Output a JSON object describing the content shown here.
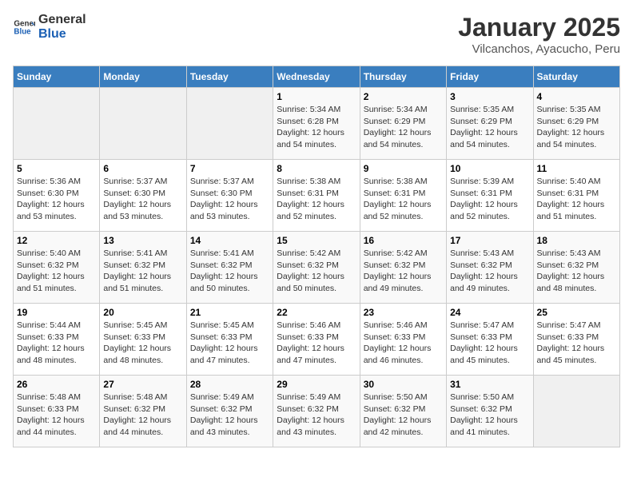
{
  "header": {
    "logo_line1": "General",
    "logo_line2": "Blue",
    "title": "January 2025",
    "subtitle": "Vilcanchos, Ayacucho, Peru"
  },
  "days_of_week": [
    "Sunday",
    "Monday",
    "Tuesday",
    "Wednesday",
    "Thursday",
    "Friday",
    "Saturday"
  ],
  "weeks": [
    [
      {
        "day": "",
        "info": ""
      },
      {
        "day": "",
        "info": ""
      },
      {
        "day": "",
        "info": ""
      },
      {
        "day": "1",
        "info": "Sunrise: 5:34 AM\nSunset: 6:28 PM\nDaylight: 12 hours\nand 54 minutes."
      },
      {
        "day": "2",
        "info": "Sunrise: 5:34 AM\nSunset: 6:29 PM\nDaylight: 12 hours\nand 54 minutes."
      },
      {
        "day": "3",
        "info": "Sunrise: 5:35 AM\nSunset: 6:29 PM\nDaylight: 12 hours\nand 54 minutes."
      },
      {
        "day": "4",
        "info": "Sunrise: 5:35 AM\nSunset: 6:29 PM\nDaylight: 12 hours\nand 54 minutes."
      }
    ],
    [
      {
        "day": "5",
        "info": "Sunrise: 5:36 AM\nSunset: 6:30 PM\nDaylight: 12 hours\nand 53 minutes."
      },
      {
        "day": "6",
        "info": "Sunrise: 5:37 AM\nSunset: 6:30 PM\nDaylight: 12 hours\nand 53 minutes."
      },
      {
        "day": "7",
        "info": "Sunrise: 5:37 AM\nSunset: 6:30 PM\nDaylight: 12 hours\nand 53 minutes."
      },
      {
        "day": "8",
        "info": "Sunrise: 5:38 AM\nSunset: 6:31 PM\nDaylight: 12 hours\nand 52 minutes."
      },
      {
        "day": "9",
        "info": "Sunrise: 5:38 AM\nSunset: 6:31 PM\nDaylight: 12 hours\nand 52 minutes."
      },
      {
        "day": "10",
        "info": "Sunrise: 5:39 AM\nSunset: 6:31 PM\nDaylight: 12 hours\nand 52 minutes."
      },
      {
        "day": "11",
        "info": "Sunrise: 5:40 AM\nSunset: 6:31 PM\nDaylight: 12 hours\nand 51 minutes."
      }
    ],
    [
      {
        "day": "12",
        "info": "Sunrise: 5:40 AM\nSunset: 6:32 PM\nDaylight: 12 hours\nand 51 minutes."
      },
      {
        "day": "13",
        "info": "Sunrise: 5:41 AM\nSunset: 6:32 PM\nDaylight: 12 hours\nand 51 minutes."
      },
      {
        "day": "14",
        "info": "Sunrise: 5:41 AM\nSunset: 6:32 PM\nDaylight: 12 hours\nand 50 minutes."
      },
      {
        "day": "15",
        "info": "Sunrise: 5:42 AM\nSunset: 6:32 PM\nDaylight: 12 hours\nand 50 minutes."
      },
      {
        "day": "16",
        "info": "Sunrise: 5:42 AM\nSunset: 6:32 PM\nDaylight: 12 hours\nand 49 minutes."
      },
      {
        "day": "17",
        "info": "Sunrise: 5:43 AM\nSunset: 6:32 PM\nDaylight: 12 hours\nand 49 minutes."
      },
      {
        "day": "18",
        "info": "Sunrise: 5:43 AM\nSunset: 6:32 PM\nDaylight: 12 hours\nand 48 minutes."
      }
    ],
    [
      {
        "day": "19",
        "info": "Sunrise: 5:44 AM\nSunset: 6:33 PM\nDaylight: 12 hours\nand 48 minutes."
      },
      {
        "day": "20",
        "info": "Sunrise: 5:45 AM\nSunset: 6:33 PM\nDaylight: 12 hours\nand 48 minutes."
      },
      {
        "day": "21",
        "info": "Sunrise: 5:45 AM\nSunset: 6:33 PM\nDaylight: 12 hours\nand 47 minutes."
      },
      {
        "day": "22",
        "info": "Sunrise: 5:46 AM\nSunset: 6:33 PM\nDaylight: 12 hours\nand 47 minutes."
      },
      {
        "day": "23",
        "info": "Sunrise: 5:46 AM\nSunset: 6:33 PM\nDaylight: 12 hours\nand 46 minutes."
      },
      {
        "day": "24",
        "info": "Sunrise: 5:47 AM\nSunset: 6:33 PM\nDaylight: 12 hours\nand 45 minutes."
      },
      {
        "day": "25",
        "info": "Sunrise: 5:47 AM\nSunset: 6:33 PM\nDaylight: 12 hours\nand 45 minutes."
      }
    ],
    [
      {
        "day": "26",
        "info": "Sunrise: 5:48 AM\nSunset: 6:33 PM\nDaylight: 12 hours\nand 44 minutes."
      },
      {
        "day": "27",
        "info": "Sunrise: 5:48 AM\nSunset: 6:32 PM\nDaylight: 12 hours\nand 44 minutes."
      },
      {
        "day": "28",
        "info": "Sunrise: 5:49 AM\nSunset: 6:32 PM\nDaylight: 12 hours\nand 43 minutes."
      },
      {
        "day": "29",
        "info": "Sunrise: 5:49 AM\nSunset: 6:32 PM\nDaylight: 12 hours\nand 43 minutes."
      },
      {
        "day": "30",
        "info": "Sunrise: 5:50 AM\nSunset: 6:32 PM\nDaylight: 12 hours\nand 42 minutes."
      },
      {
        "day": "31",
        "info": "Sunrise: 5:50 AM\nSunset: 6:32 PM\nDaylight: 12 hours\nand 41 minutes."
      },
      {
        "day": "",
        "info": ""
      }
    ]
  ]
}
